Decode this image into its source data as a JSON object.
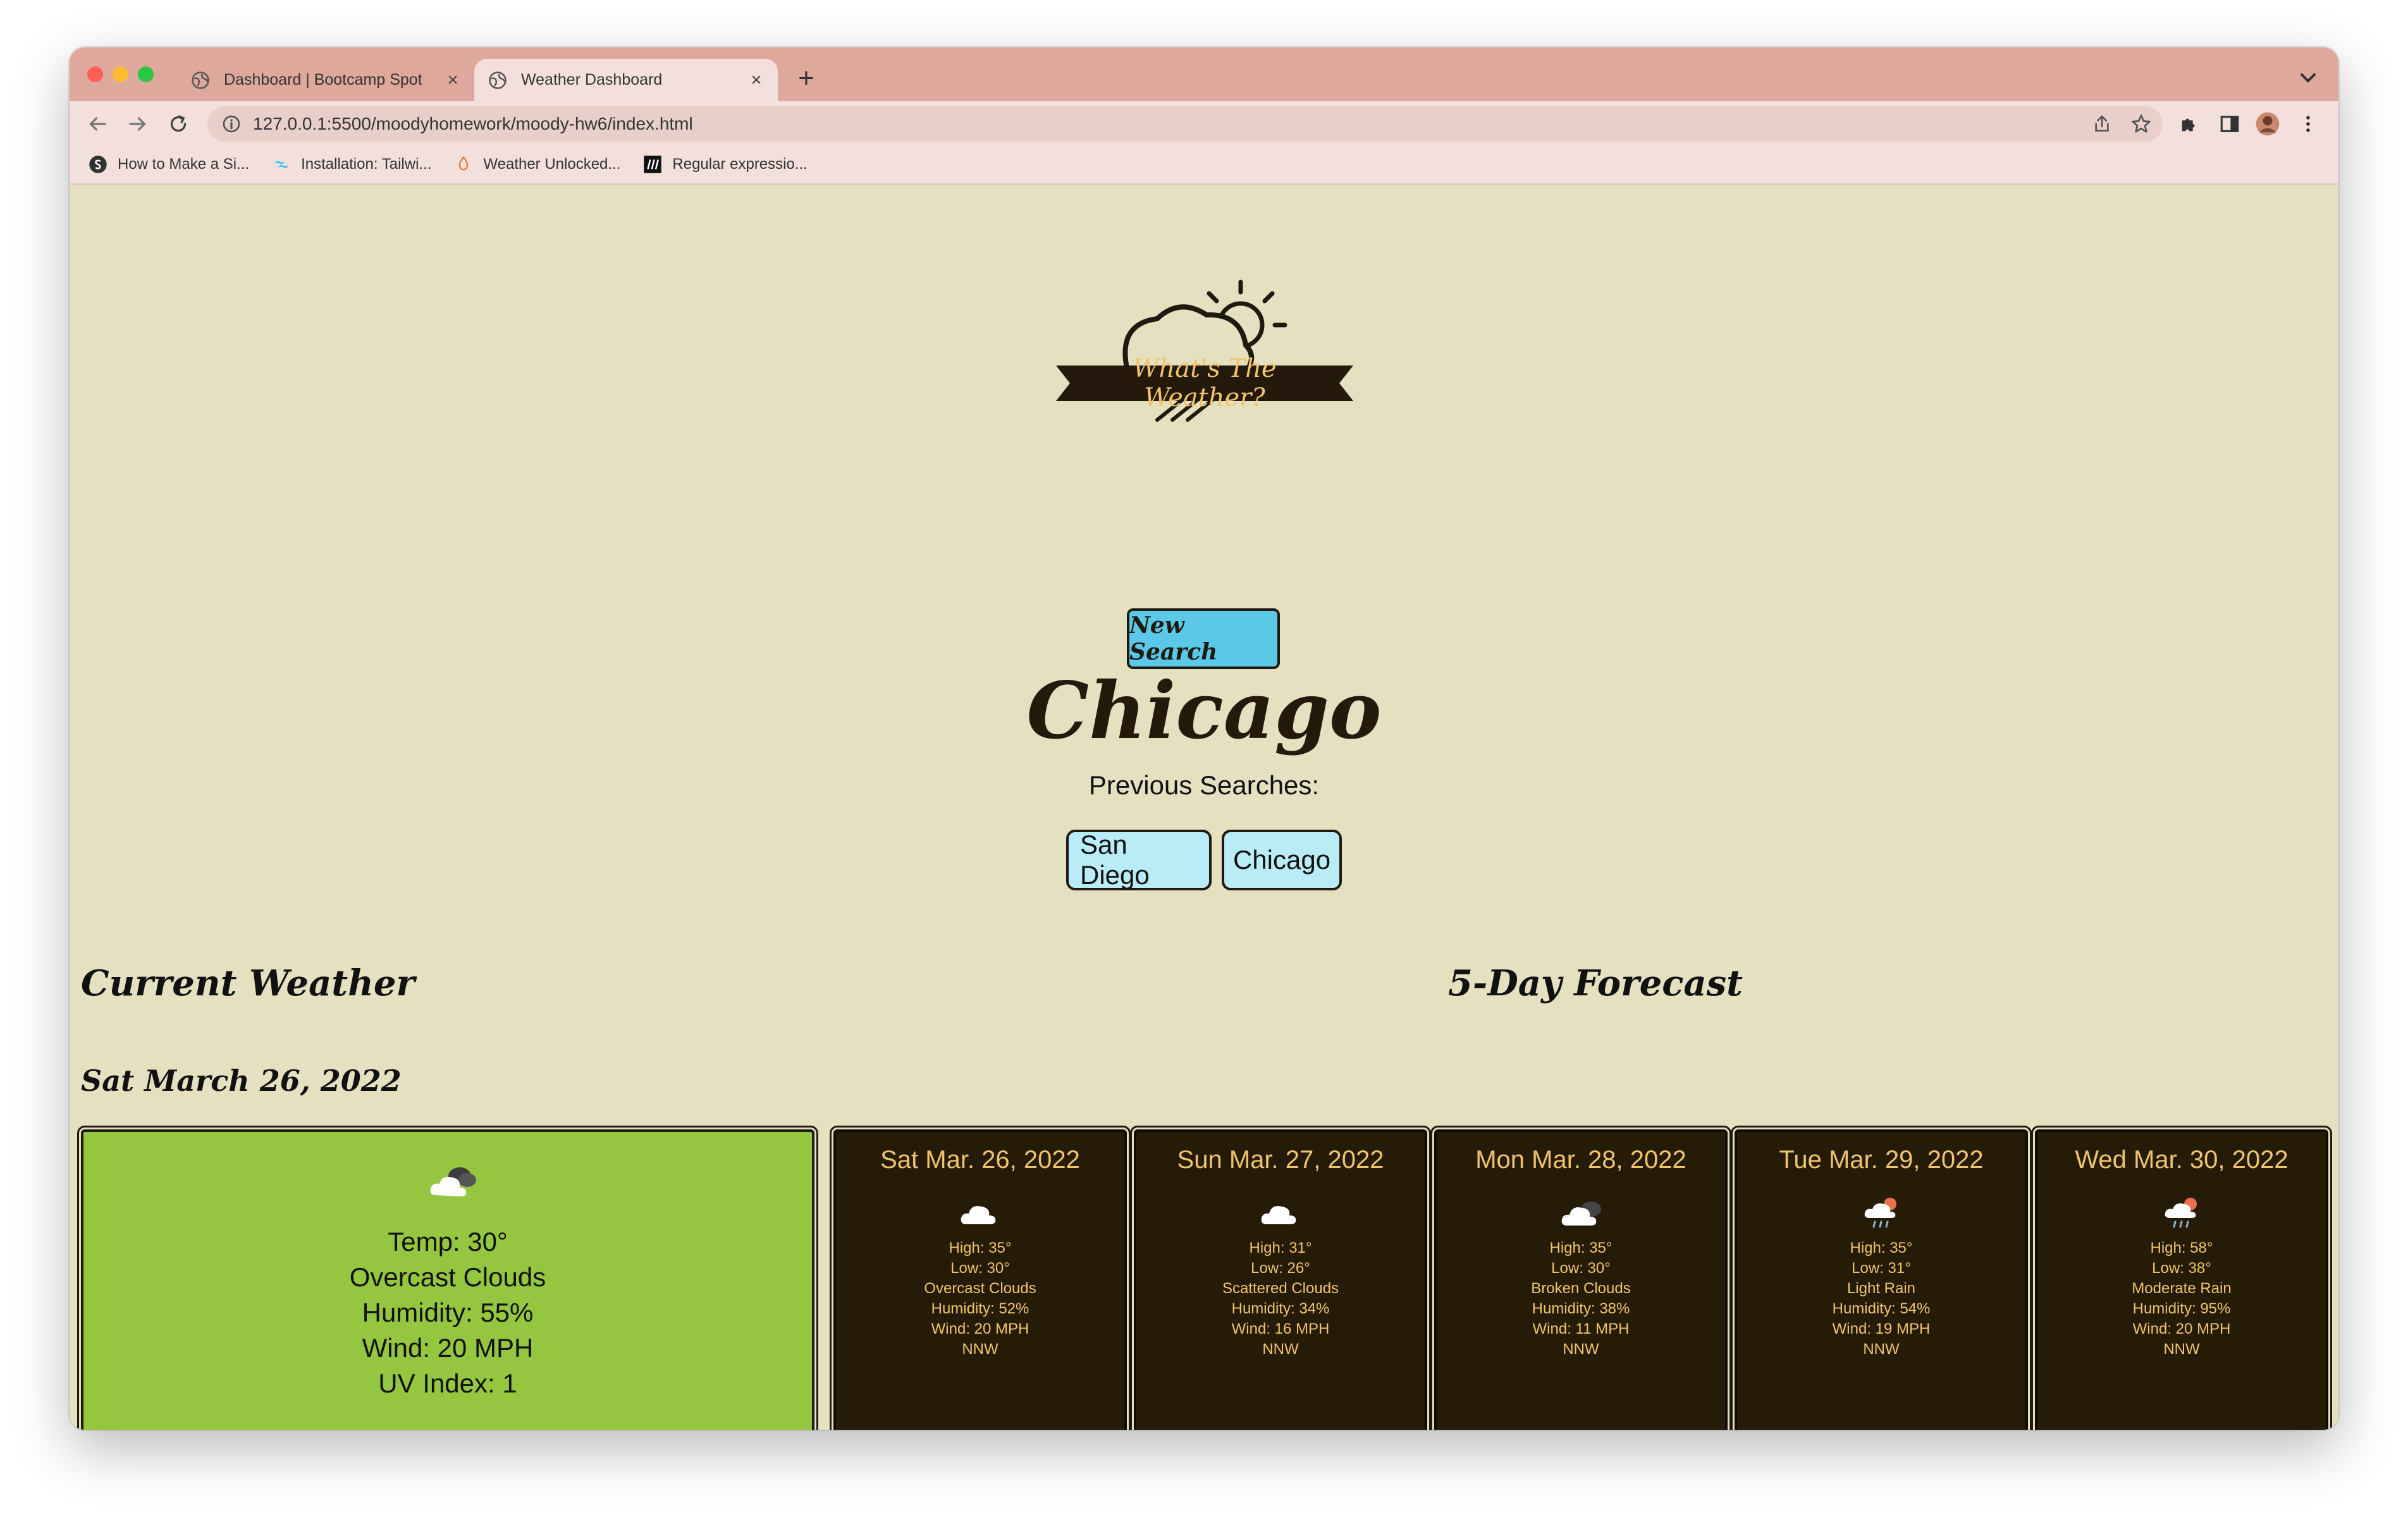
{
  "browser": {
    "tabs": [
      {
        "title": "Dashboard | Bootcamp Spot",
        "close": "×"
      },
      {
        "title": "Weather Dashboard",
        "close": "×"
      }
    ],
    "new_tab": "+",
    "url": "127.0.0.1:5500/moodyhomework/moody-hw6/index.html",
    "bookmarks": [
      {
        "label": "How to Make a Si...",
        "icon": "circle-s-icon"
      },
      {
        "label": "Installation: Tailwi...",
        "icon": "tailwind-icon"
      },
      {
        "label": "Weather Unlocked...",
        "icon": "weather-unlocked-icon"
      },
      {
        "label": "Regular expressio...",
        "icon": "mdn-icon"
      }
    ]
  },
  "page": {
    "logo_text": "What's The Weather?",
    "new_search": "New Search",
    "city": "Chicago",
    "previous_label": "Previous Searches:",
    "previous": [
      "San Diego",
      "Chicago"
    ],
    "current_title": "Current Weather",
    "forecast_title": "5-Day Forecast",
    "current_date": "Sat March 26, 2022",
    "current": {
      "icon": "overcast-clouds-icon",
      "temp": "Temp: 30°",
      "desc": "Overcast Clouds",
      "humidity": "Humidity: 55%",
      "wind": "Wind: 20 MPH",
      "uv": "UV Index: 1"
    },
    "forecast": [
      {
        "date": "Sat Mar. 26, 2022",
        "icon": "cloud-icon",
        "high": "High: 35°",
        "low": "Low: 30°",
        "desc": "Overcast Clouds",
        "humidity": "Humidity: 52%",
        "wind": "Wind: 20 MPH",
        "dir": "NNW"
      },
      {
        "date": "Sun Mar. 27, 2022",
        "icon": "cloud-icon",
        "high": "High: 31°",
        "low": "Low: 26°",
        "desc": "Scattered Clouds",
        "humidity": "Humidity: 34%",
        "wind": "Wind: 16 MPH",
        "dir": "NNW"
      },
      {
        "date": "Mon Mar. 28, 2022",
        "icon": "broken-clouds-icon",
        "high": "High: 35°",
        "low": "Low: 30°",
        "desc": "Broken Clouds",
        "humidity": "Humidity: 38%",
        "wind": "Wind: 11 MPH",
        "dir": "NNW"
      },
      {
        "date": "Tue Mar. 29, 2022",
        "icon": "rain-icon",
        "high": "High: 35°",
        "low": "Low: 31°",
        "desc": "Light Rain",
        "humidity": "Humidity: 54%",
        "wind": "Wind: 19 MPH",
        "dir": "NNW"
      },
      {
        "date": "Wed Mar. 30, 2022",
        "icon": "rain-icon",
        "high": "High: 58°",
        "low": "Low: 38°",
        "desc": "Moderate Rain",
        "humidity": "Humidity: 95%",
        "wind": "Wind: 20 MPH",
        "dir": "NNW"
      }
    ]
  },
  "colors": {
    "page_bg": "#e5e0c0",
    "tab_strip": "#dfa89c",
    "current_card": "#94c640",
    "forecast_card": "#261b07",
    "forecast_text": "#f0c46c",
    "new_search_btn": "#5bc8e8",
    "prev_btn": "#b9ecf7"
  }
}
